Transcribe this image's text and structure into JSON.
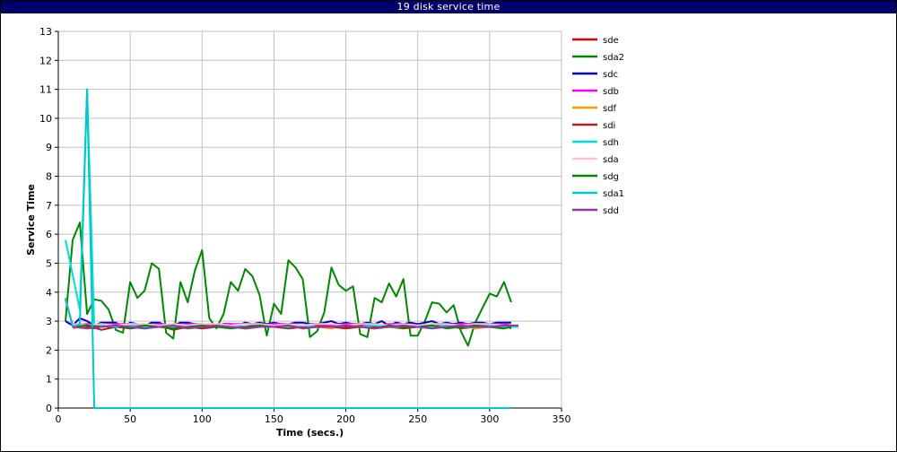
{
  "chart_data": {
    "type": "line",
    "title": "19 disk service time",
    "xlabel": "Time (secs.)",
    "ylabel": "Service Time",
    "xlim": [
      0,
      350
    ],
    "ylim": [
      0,
      13
    ],
    "xticks": [
      0,
      50,
      100,
      150,
      200,
      250,
      300,
      350
    ],
    "yticks": [
      0,
      1,
      2,
      3,
      4,
      5,
      6,
      7,
      8,
      9,
      10,
      11,
      12,
      13
    ],
    "grid": true,
    "legend_position": "right",
    "series": [
      {
        "name": "sde",
        "color": "#e00000",
        "x": [
          5,
          10,
          15,
          20,
          25,
          30,
          35,
          40,
          45,
          50,
          60,
          70,
          80,
          90,
          100,
          110,
          120,
          130,
          140,
          150,
          160,
          170,
          180,
          190,
          200,
          210,
          220,
          230,
          240,
          250,
          260,
          270,
          280,
          290,
          300,
          310,
          315
        ],
        "y": [
          3.75,
          2.85,
          2.9,
          2.8,
          2.75,
          2.85,
          2.8,
          2.85,
          2.8,
          2.85,
          2.8,
          2.85,
          2.85,
          2.8,
          2.85,
          2.8,
          2.85,
          2.8,
          2.85,
          2.85,
          2.8,
          2.85,
          2.8,
          2.85,
          2.8,
          2.85,
          2.8,
          2.85,
          2.8,
          2.85,
          2.8,
          2.85,
          2.8,
          2.85,
          2.8,
          2.85,
          2.75
        ]
      },
      {
        "name": "sda2",
        "color": "#008800",
        "x": [
          5,
          10,
          15,
          20,
          25,
          30,
          35,
          40,
          45,
          50,
          55,
          60,
          65,
          70,
          75,
          80,
          85,
          90,
          95,
          100,
          105,
          110,
          115,
          120,
          125,
          130,
          135,
          140,
          145,
          150,
          155,
          160,
          165,
          170,
          175,
          180,
          185,
          190,
          195,
          200,
          205,
          210,
          215,
          220,
          225,
          230,
          235,
          240,
          245,
          250,
          255,
          260,
          265,
          270,
          275,
          280,
          285,
          290,
          295,
          300,
          305,
          310,
          315
        ],
        "y": [
          3.0,
          5.8,
          6.4,
          3.25,
          3.75,
          3.7,
          3.4,
          2.7,
          2.6,
          4.35,
          3.8,
          4.05,
          5.0,
          4.8,
          2.6,
          2.4,
          4.35,
          3.65,
          4.75,
          5.45,
          3.1,
          2.75,
          3.25,
          4.35,
          4.05,
          4.8,
          4.55,
          3.9,
          2.5,
          3.6,
          3.25,
          5.1,
          4.85,
          4.45,
          2.45,
          2.65,
          3.3,
          4.85,
          4.25,
          4.05,
          4.2,
          2.55,
          2.45,
          3.8,
          3.65,
          4.3,
          3.85,
          4.45,
          2.5,
          2.5,
          3.0,
          3.65,
          3.6,
          3.3,
          3.55,
          2.65,
          2.15,
          2.95,
          3.45,
          3.95,
          3.85,
          4.35,
          3.65
        ]
      },
      {
        "name": "sdc",
        "color": "#0000cc",
        "x": [
          5,
          10,
          15,
          20,
          25,
          30,
          35,
          40,
          45,
          50,
          55,
          60,
          65,
          70,
          75,
          80,
          85,
          90,
          95,
          100,
          105,
          110,
          115,
          120,
          125,
          130,
          135,
          140,
          145,
          150,
          155,
          160,
          165,
          170,
          175,
          180,
          185,
          190,
          195,
          200,
          205,
          210,
          215,
          220,
          225,
          230,
          235,
          240,
          245,
          250,
          255,
          260,
          265,
          270,
          275,
          280,
          285,
          290,
          295,
          300,
          305,
          310,
          315
        ],
        "y": [
          3.0,
          2.85,
          3.1,
          3.0,
          2.85,
          2.95,
          2.95,
          2.95,
          2.8,
          2.95,
          2.9,
          2.85,
          2.95,
          2.95,
          2.85,
          2.85,
          2.95,
          2.95,
          2.9,
          2.85,
          2.9,
          2.85,
          2.9,
          2.9,
          2.85,
          2.95,
          2.9,
          2.95,
          2.9,
          2.95,
          2.9,
          2.9,
          2.95,
          2.95,
          2.9,
          2.9,
          2.95,
          3.0,
          2.9,
          2.95,
          2.9,
          2.9,
          2.95,
          2.9,
          3.0,
          2.85,
          2.95,
          2.9,
          2.95,
          2.9,
          2.95,
          3.0,
          2.9,
          2.95,
          2.9,
          2.95,
          2.9,
          2.95,
          2.95,
          2.9,
          2.95,
          2.95,
          2.95
        ]
      },
      {
        "name": "sdb",
        "color": "#ff00ff",
        "x": [
          10,
          20,
          30,
          40,
          50,
          60,
          70,
          80,
          90,
          100,
          110,
          120,
          130,
          140,
          150,
          160,
          170,
          180,
          190,
          200,
          210,
          220,
          230,
          240,
          250,
          260,
          270,
          280,
          290,
          300,
          310,
          315
        ],
        "y": [
          2.85,
          2.9,
          2.85,
          2.9,
          2.9,
          2.85,
          2.9,
          2.85,
          2.9,
          2.9,
          2.85,
          2.9,
          2.9,
          2.85,
          2.9,
          2.9,
          2.85,
          2.9,
          2.85,
          2.9,
          2.9,
          2.85,
          2.9,
          2.9,
          2.85,
          2.9,
          2.85,
          2.9,
          2.9,
          2.85,
          2.9,
          2.85
        ]
      },
      {
        "name": "sdf",
        "color": "#ff9900",
        "x": [
          10,
          15,
          20,
          30,
          40,
          50,
          60,
          70,
          80,
          90,
          100,
          110,
          120,
          130,
          140,
          150,
          160,
          170,
          180,
          190,
          200,
          210,
          220,
          230,
          240,
          250,
          260,
          270,
          280,
          290,
          300,
          310,
          315
        ],
        "y": [
          2.75,
          2.8,
          2.75,
          2.8,
          2.85,
          2.8,
          2.75,
          2.85,
          2.8,
          2.75,
          2.8,
          2.85,
          2.8,
          2.75,
          2.8,
          2.85,
          2.75,
          2.8,
          2.8,
          2.75,
          2.85,
          2.8,
          2.75,
          2.8,
          2.85,
          2.8,
          2.75,
          2.8,
          2.85,
          2.75,
          2.8,
          2.8,
          2.8
        ]
      },
      {
        "name": "sdi",
        "color": "#aa2222",
        "x": [
          10,
          20,
          30,
          40,
          50,
          60,
          70,
          80,
          90,
          100,
          110,
          120,
          130,
          140,
          150,
          160,
          170,
          180,
          190,
          200,
          210,
          220,
          230,
          240,
          250,
          260,
          270,
          280,
          290,
          300,
          310,
          315
        ],
        "y": [
          2.8,
          2.85,
          2.7,
          2.8,
          2.75,
          2.8,
          2.85,
          2.7,
          2.8,
          2.75,
          2.8,
          2.85,
          2.75,
          2.8,
          2.8,
          2.75,
          2.8,
          2.85,
          2.8,
          2.75,
          2.8,
          2.85,
          2.8,
          2.75,
          2.8,
          2.8,
          2.85,
          2.75,
          2.8,
          2.8,
          2.75,
          2.8
        ]
      },
      {
        "name": "sdh",
        "color": "#00dddd",
        "x": [
          5,
          15,
          20,
          25,
          30,
          40,
          50,
          60,
          70,
          80,
          90,
          100,
          110,
          120,
          130,
          140,
          150,
          160,
          170,
          180,
          190,
          200,
          210,
          220,
          230,
          240,
          250,
          260,
          270,
          280,
          290,
          300,
          310,
          320
        ],
        "y": [
          5.8,
          3.4,
          11.0,
          2.8,
          2.85,
          2.8,
          2.85,
          2.8,
          2.85,
          2.8,
          2.8,
          2.85,
          2.8,
          2.85,
          2.8,
          2.8,
          2.85,
          2.8,
          2.85,
          2.8,
          2.8,
          2.85,
          2.8,
          2.85,
          2.8,
          2.8,
          2.85,
          2.8,
          2.85,
          2.8,
          2.8,
          2.85,
          2.8,
          2.8
        ]
      },
      {
        "name": "sda",
        "color": "#ffc0cb",
        "x": [
          10,
          20,
          30,
          40,
          50,
          60,
          70,
          80,
          90,
          100,
          110,
          120,
          130,
          140,
          150,
          160,
          170,
          180,
          190,
          200,
          210,
          220,
          230,
          240,
          250,
          260,
          270,
          280,
          290,
          300,
          310
        ],
        "y": [
          2.9,
          2.85,
          2.9,
          2.85,
          2.9,
          2.9,
          2.85,
          2.9,
          2.85,
          2.9,
          2.9,
          2.85,
          2.9,
          2.9,
          2.85,
          2.9,
          2.85,
          2.9,
          2.9,
          2.85,
          2.9,
          2.9,
          2.85,
          2.9,
          2.85,
          2.9,
          2.9,
          2.85,
          2.9,
          2.9,
          2.85
        ]
      },
      {
        "name": "sdg",
        "color": "#008800",
        "x": [
          10,
          20,
          30,
          40,
          50,
          60,
          70,
          80,
          90,
          100,
          110,
          120,
          130,
          140,
          150,
          160,
          170,
          180,
          190,
          200,
          210,
          220,
          230,
          240,
          250,
          260,
          270,
          280,
          290,
          300,
          310,
          315
        ],
        "y": [
          2.8,
          2.85,
          2.8,
          2.85,
          2.75,
          2.85,
          2.8,
          2.75,
          2.8,
          2.85,
          2.8,
          2.75,
          2.8,
          2.85,
          2.8,
          2.85,
          2.75,
          2.8,
          2.8,
          2.85,
          2.8,
          2.75,
          2.85,
          2.8,
          2.8,
          2.85,
          2.75,
          2.8,
          2.85,
          2.8,
          2.75,
          2.8
        ]
      },
      {
        "name": "sda1",
        "color": "#00c8c8",
        "x": [
          5,
          10,
          15,
          20,
          25,
          30,
          50,
          100,
          150,
          200,
          250,
          300,
          315
        ],
        "y": [
          3.8,
          2.8,
          2.9,
          11.0,
          0.0,
          0.0,
          0.0,
          0.0,
          0.0,
          0.0,
          0.0,
          0.0,
          0.0
        ]
      },
      {
        "name": "sdd",
        "color": "#9933aa",
        "x": [
          10,
          20,
          30,
          40,
          50,
          60,
          70,
          80,
          90,
          100,
          110,
          120,
          130,
          140,
          150,
          160,
          170,
          180,
          190,
          200,
          210,
          220,
          230,
          240,
          250,
          260,
          270,
          280,
          290,
          300,
          310,
          320
        ],
        "y": [
          2.8,
          2.75,
          2.8,
          2.85,
          2.8,
          2.75,
          2.8,
          2.85,
          2.75,
          2.8,
          2.85,
          2.8,
          2.75,
          2.8,
          2.8,
          2.85,
          2.75,
          2.8,
          2.8,
          2.85,
          2.8,
          2.75,
          2.8,
          2.85,
          2.8,
          2.75,
          2.8,
          2.85,
          2.8,
          2.8,
          2.85,
          2.85
        ]
      }
    ]
  }
}
